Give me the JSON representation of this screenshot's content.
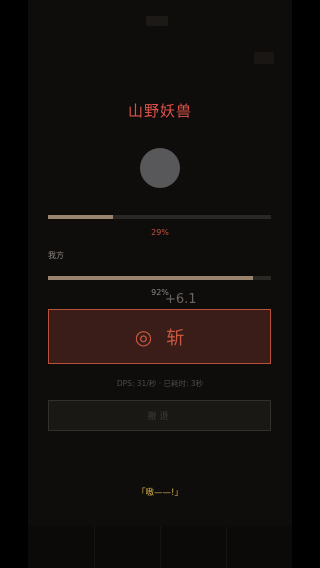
{
  "enemy": {
    "name": "山野妖兽",
    "hp_fraction": 0.29,
    "hp_percent_text": "29%"
  },
  "player": {
    "label": "我方",
    "hp_fraction": 0.92,
    "hp_percent_text": "92%"
  },
  "floating_gain": "+6.1",
  "slash_button": {
    "icon": "◎",
    "label": "斩"
  },
  "stats_line": "DPS: 31/秒 · 已耗时: 3秒",
  "flee_button": {
    "label": "撤退"
  },
  "shout": "「嗷——!」",
  "colors": {
    "enemy_name": "#e0504a",
    "bar_fill": "#9a8470",
    "slash_border": "#b8503c",
    "shout": "#d8b24a"
  }
}
